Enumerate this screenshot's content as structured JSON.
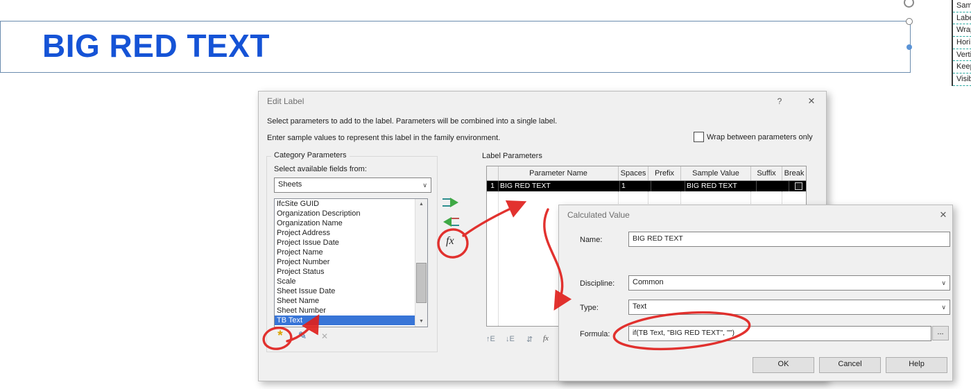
{
  "colors": {
    "annotation_red": "#e0201d",
    "label_blue": "#1553d6",
    "list_selection_blue": "#3875d7",
    "selected_row_bg": "#000000"
  },
  "label_preview": {
    "text": "BIG RED TEXT"
  },
  "properties_panel": {
    "rows": [
      "Samp",
      "Labe",
      "Wrap",
      "Hori",
      "Verti",
      "Keep",
      "Visib"
    ]
  },
  "edit_label": {
    "title": "Edit Label",
    "instruction1": "Select parameters to add to the label.  Parameters will be combined into a single label.",
    "instruction2": "Enter sample values to represent this label in the family environment.",
    "wrap_checkbox_label": "Wrap between parameters only",
    "category": {
      "group_title": "Category Parameters",
      "fields_label": "Select available fields from:",
      "selected_category": "Sheets",
      "items": [
        "IfcSite GUID",
        "Organization Description",
        "Organization Name",
        "Project Address",
        "Project Issue Date",
        "Project Name",
        "Project Number",
        "Project Status",
        "Scale",
        "Sheet Issue Date",
        "Sheet Name",
        "Sheet Number",
        "TB Text"
      ],
      "selected_item": "TB Text"
    },
    "params": {
      "group_title": "Label Parameters",
      "columns": {
        "num": "",
        "name": "Parameter Name",
        "spaces": "Spaces",
        "prefix": "Prefix",
        "sample": "Sample Value",
        "suffix": "Suffix",
        "break": "Break"
      },
      "row1": {
        "num": "1",
        "name": "BIG RED TEXT",
        "spaces": "1",
        "prefix": "",
        "sample": "BIG RED TEXT",
        "suffix": ""
      }
    }
  },
  "calculated_value": {
    "title": "Calculated Value",
    "name_label": "Name:",
    "name_value": "BIG RED TEXT",
    "discipline_label": "Discipline:",
    "discipline_value": "Common",
    "type_label": "Type:",
    "type_value": "Text",
    "formula_label": "Formula:",
    "formula_value": "if(TB Text, \"BIG RED TEXT\", \"\")",
    "browse_button": "...",
    "ok_button": "OK",
    "cancel_button": "Cancel",
    "help_button": "Help"
  },
  "icons": {
    "help": "?",
    "close": "✕",
    "chevron_down": "∨",
    "scroll_up": "▲",
    "scroll_down": "▼",
    "new_parameter": "*",
    "edit_parameter": "✎",
    "delete_parameter": "✕",
    "fx": "fx",
    "move_up": "↑E",
    "move_down": "↓E",
    "reorder": "⇵",
    "fx_edit": "fx"
  }
}
